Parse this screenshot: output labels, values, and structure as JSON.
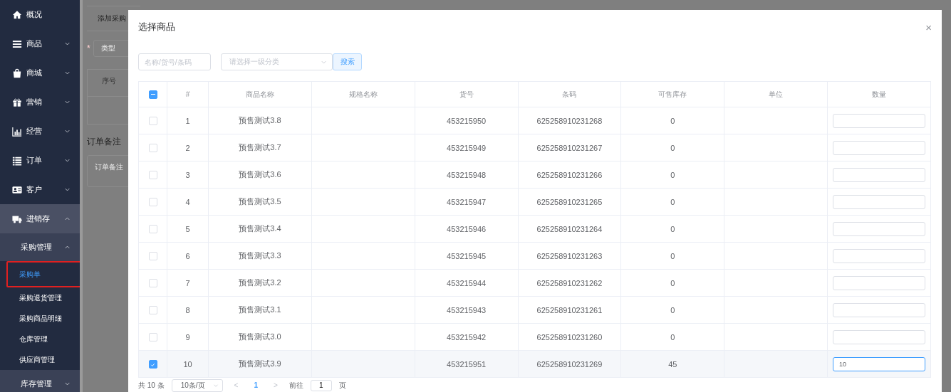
{
  "sidebar": {
    "items": [
      {
        "label": "概况"
      },
      {
        "label": "商品",
        "expanded": false
      },
      {
        "label": "商城",
        "expanded": false
      },
      {
        "label": "营销",
        "expanded": false
      },
      {
        "label": "经营",
        "expanded": false
      },
      {
        "label": "订单",
        "expanded": false
      },
      {
        "label": "客户",
        "expanded": false
      },
      {
        "label": "进销存",
        "expanded": true,
        "children": [
          {
            "label": "采购管理",
            "expanded": true,
            "children": [
              {
                "label": "采购单",
                "selected": true
              },
              {
                "label": "采购退货管理",
                "selected": false
              },
              {
                "label": "采购商品明细",
                "selected": false
              },
              {
                "label": "仓库管理",
                "selected": false
              },
              {
                "label": "供应商管理",
                "selected": false
              }
            ]
          },
          {
            "label": "库存管理",
            "expanded": false
          }
        ]
      }
    ]
  },
  "background_page": {
    "title": "添加采购",
    "required_mark": "*",
    "type_placeholder": "类型",
    "table_header": "序号",
    "remark_heading": "订单备注",
    "remark_placeholder": "订单备注"
  },
  "dialog": {
    "title": "选择商品",
    "close": "×",
    "search_placeholder": "名称/货号/条码",
    "category_placeholder": "请选择一级分类",
    "search_button": "搜索",
    "table": {
      "indeterminate": true,
      "columns": [
        "#",
        "商品名称",
        "规格名称",
        "货号",
        "条码",
        "可售库存",
        "单位",
        "数量"
      ],
      "rows": [
        {
          "no": "1",
          "name": "预售测试3.8",
          "sku": "453215950",
          "barcode": "625258910231268",
          "stock": "0",
          "quantity": "",
          "checked": false,
          "focused": false
        },
        {
          "no": "2",
          "name": "预售测试3.7",
          "sku": "453215949",
          "barcode": "625258910231267",
          "stock": "0",
          "quantity": "",
          "checked": false,
          "focused": false
        },
        {
          "no": "3",
          "name": "预售测试3.6",
          "sku": "453215948",
          "barcode": "625258910231266",
          "stock": "0",
          "quantity": "",
          "checked": false,
          "focused": false
        },
        {
          "no": "4",
          "name": "预售测试3.5",
          "sku": "453215947",
          "barcode": "625258910231265",
          "stock": "0",
          "quantity": "",
          "checked": false,
          "focused": false
        },
        {
          "no": "5",
          "name": "预售测试3.4",
          "sku": "453215946",
          "barcode": "625258910231264",
          "stock": "0",
          "quantity": "",
          "checked": false,
          "focused": false
        },
        {
          "no": "6",
          "name": "预售测试3.3",
          "sku": "453215945",
          "barcode": "625258910231263",
          "stock": "0",
          "quantity": "",
          "checked": false,
          "focused": false
        },
        {
          "no": "7",
          "name": "预售测试3.2",
          "sku": "453215944",
          "barcode": "625258910231262",
          "stock": "0",
          "quantity": "",
          "checked": false,
          "focused": false
        },
        {
          "no": "8",
          "name": "预售测试3.1",
          "sku": "453215943",
          "barcode": "625258910231261",
          "stock": "0",
          "quantity": "",
          "checked": false,
          "focused": false
        },
        {
          "no": "9",
          "name": "预售测试3.0",
          "sku": "453215942",
          "barcode": "625258910231260",
          "stock": "0",
          "quantity": "",
          "checked": false,
          "focused": false
        },
        {
          "no": "10",
          "name": "预售测试3.9",
          "sku": "453215951",
          "barcode": "625258910231269",
          "stock": "45",
          "quantity": "10",
          "checked": true,
          "focused": true
        }
      ]
    },
    "pagination": {
      "total": "共 10 条",
      "page_size": "10条/页",
      "prev": "<",
      "pages": [
        {
          "label": "1",
          "selected": true
        }
      ],
      "next": ">",
      "goto_label": "前往",
      "goto_value": "1",
      "goto_suffix": "页"
    }
  }
}
